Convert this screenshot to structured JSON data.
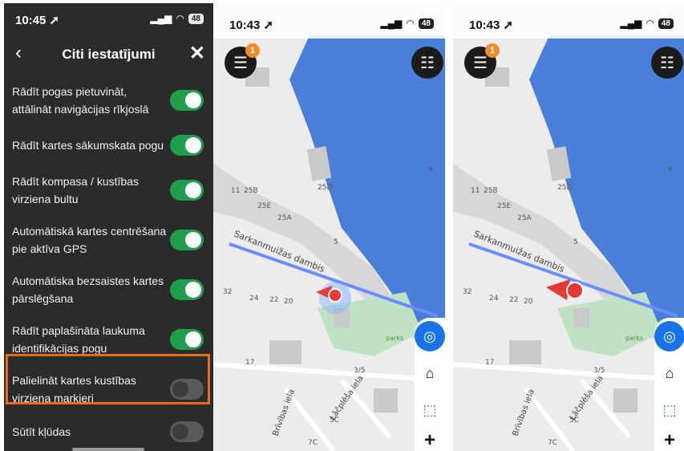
{
  "settings": {
    "status": {
      "time": "10:45 ➚",
      "signal": "▂▄▆",
      "wifi": "◠",
      "battery": "48"
    },
    "title": "Citi iestatījumi",
    "back_icon": "‹",
    "close_icon": "✕",
    "items": [
      {
        "label": "Rādīt pogas pietuvināt, attālināt navigācijas rīkjoslā",
        "enabled": true
      },
      {
        "label": "Rādīt kartes sākumskata pogu",
        "enabled": true
      },
      {
        "label": "Rādīt kompasa / kustības virziena bultu",
        "enabled": true
      },
      {
        "label": "Automātiskā kartes centrēšana pie aktīva GPS",
        "enabled": true
      },
      {
        "label": "Automātiska bezsaistes kartes pārslēgšana",
        "enabled": true
      },
      {
        "label": "Rādīt paplašināta laukuma identifikācijas pogu",
        "enabled": true
      },
      {
        "label": "Palielināt kartes kustības virziena marķieri",
        "enabled": false
      },
      {
        "label": "Sūtīt kļūdas",
        "enabled": false
      }
    ]
  },
  "maps": [
    {
      "status": {
        "time": "10:43 ➚",
        "signal": "▂▄▆",
        "wifi": "◠",
        "battery": "48"
      },
      "badge": "1"
    },
    {
      "status": {
        "time": "10:43 ➚",
        "signal": "▂▄▆",
        "wifi": "◠",
        "battery": "48"
      },
      "badge": "1"
    }
  ],
  "map_labels": {
    "street1": "Sarkanmuižas dambis",
    "street2": "Brīvības iela",
    "street3": "Lāčplēša iela",
    "street4": "Brīvības iela",
    "park": "parks",
    "n1": "11",
    "n2": "25B",
    "n3": "25E",
    "n4": "25A",
    "n5": "25D",
    "n6": "32",
    "n7": "24",
    "n8": "22",
    "n9": "20",
    "n10": "5",
    "n11": "3/5",
    "n12": "7C",
    "n13": "5C",
    "n14": "17",
    "n15": "9"
  },
  "icons": {
    "menu": "☰",
    "list": "☷",
    "locate": "◎",
    "home": "⌂",
    "area": "⬚",
    "zoom_in": "+"
  }
}
